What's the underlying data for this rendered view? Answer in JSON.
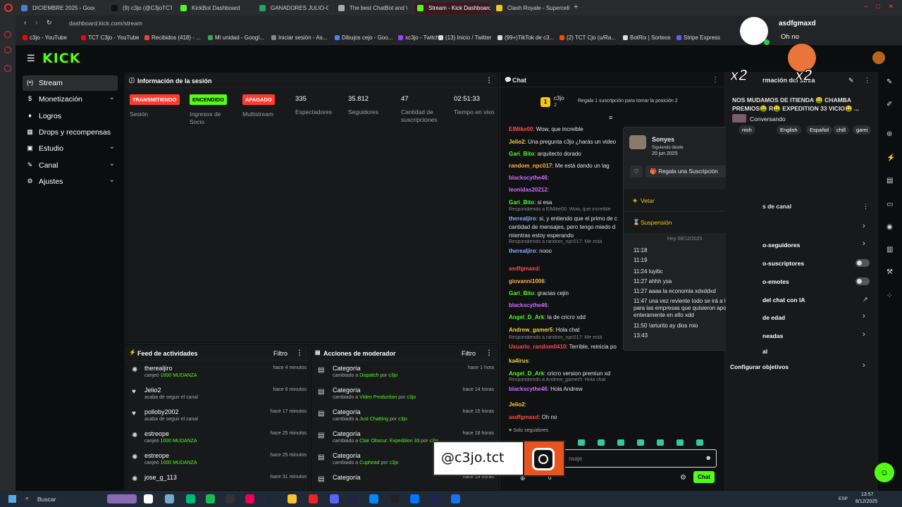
{
  "browser": {
    "tabs": [
      {
        "label": "DICIEMBRE 2025 - Goog",
        "color": "#4a7fd4"
      },
      {
        "label": "(9) c3jo (@C3joTCT) / X",
        "color": "#111111"
      },
      {
        "label": "KickBot Dashboard",
        "color": "#53fc18"
      },
      {
        "label": "GANADORES JULIO-OCT",
        "color": "#21a366"
      },
      {
        "label": "The best ChatBot and W",
        "color": "#aaaaaa"
      },
      {
        "label": "Stream - Kick Dashboard",
        "color": "#53fc18"
      },
      {
        "label": "Clash Royale - Supercell",
        "color": "#f4c430"
      }
    ],
    "url": "dashboard.kick.com/stream",
    "bookmarks": [
      {
        "label": "c3jo - YouTube",
        "color": "#ff0000"
      },
      {
        "label": "TCT C3jo - YouTube",
        "color": "#ff0000"
      },
      {
        "label": "Recibidos (418) - ...",
        "color": "#ea4335"
      },
      {
        "label": "Mi unidad - Googl...",
        "color": "#34a853"
      },
      {
        "label": "Iniciar sesión - As...",
        "color": "#888888"
      },
      {
        "label": "Dibujos cejo - Goo...",
        "color": "#4285f4"
      },
      {
        "label": "xc3jo - Twitch",
        "color": "#9146ff"
      },
      {
        "label": "(13) Inicio / Twitter",
        "color": "#dddddd"
      },
      {
        "label": "(99+)TikTok de c3...",
        "color": "#dddddd"
      },
      {
        "label": "(2) TCT Cjo (u/Ra...",
        "color": "#ff4500"
      },
      {
        "label": "BotRix | Sorteos",
        "color": "#dddddd"
      },
      {
        "label": "Stripe Express",
        "color": "#635bff"
      }
    ]
  },
  "kick": {
    "logo": "KICK",
    "sidebar": [
      {
        "label": "Stream",
        "icon": "(•)",
        "chevron": false,
        "active": true
      },
      {
        "label": "Monetización",
        "icon": "$",
        "chevron": true,
        "active": false
      },
      {
        "label": "Logros",
        "icon": "♦",
        "chevron": false,
        "active": false
      },
      {
        "label": "Drops y recompensas",
        "icon": "▦",
        "chevron": false,
        "active": false
      },
      {
        "label": "Estudio",
        "icon": "▣",
        "chevron": true,
        "active": false
      },
      {
        "label": "Canal",
        "icon": "✎",
        "chevron": true,
        "active": false
      },
      {
        "label": "Ajustes",
        "icon": "⚙",
        "chevron": true,
        "active": false
      }
    ],
    "session": {
      "title": "Información de la sesión",
      "badges": [
        {
          "text": "TRANSMITIENDO",
          "label": "Sesión",
          "bg": "#ff3b30",
          "fg": "#ffffff"
        },
        {
          "text": "ENCENDIDO",
          "label": "Ingresos de Socio",
          "bg": "#53fc18",
          "fg": "#000000"
        },
        {
          "text": "APAGADO",
          "label": "Multistream",
          "bg": "#ff3b30",
          "fg": "#ffffff"
        }
      ],
      "stats": [
        {
          "value": "335",
          "label": "Espectadores"
        },
        {
          "value": "35.812",
          "label": "Seguidores"
        },
        {
          "value": "47",
          "label": "Cantidad de suscripciones"
        },
        {
          "value": "02:51:33",
          "label": "Tiempo en vivo"
        }
      ]
    },
    "feed": {
      "title": "Feed de actividades",
      "filter": "Filtro",
      "items": [
        {
          "name": "therealjiro",
          "pre": "canjeó ",
          "hl": "1000 MUDANZA",
          "post": "",
          "time": "hace 4 minutos",
          "icon": "✺"
        },
        {
          "name": "Jelio2",
          "pre": "acaba de seguir el canal",
          "hl": "",
          "post": "",
          "time": "hace 6 minutos",
          "icon": "♥"
        },
        {
          "name": "polloby2002",
          "pre": "acaba de seguir el canal",
          "hl": "",
          "post": "",
          "time": "hace 17 minutos",
          "icon": "♥"
        },
        {
          "name": "estreope",
          "pre": "canjeó ",
          "hl": "1000 MUDANZA",
          "post": "",
          "time": "hace 25 minutos",
          "icon": "✺"
        },
        {
          "name": "estreope",
          "pre": "canjeó ",
          "hl": "1000 MUDANZA",
          "post": "",
          "time": "hace 25 minutos",
          "icon": "✺"
        },
        {
          "name": "jose_g_113",
          "pre": "",
          "hl": "",
          "post": "",
          "time": "hace 31 minutos",
          "icon": "✺"
        }
      ]
    },
    "mod": {
      "title": "Acciones de moderador",
      "filter": "Filtro",
      "items": [
        {
          "name": "Categoría",
          "pre": "cambiado a ",
          "hl": "Dispatch",
          "post": " por ",
          "user": "c3jo",
          "time": "hace 1 hora"
        },
        {
          "name": "Categoría",
          "pre": "cambiado a ",
          "hl": "Video Production",
          "post": " por ",
          "user": "c3jo",
          "time": "hace 14 horas"
        },
        {
          "name": "Categoría",
          "pre": "cambiado a ",
          "hl": "Just Chatting",
          "post": " por ",
          "user": "c3jo",
          "time": "hace 15 horas"
        },
        {
          "name": "Categoría",
          "pre": "cambiado a ",
          "hl": "Clair Obscur: Expedition 33",
          "post": " por ",
          "user": "c3jo",
          "time": "hace 18 horas"
        },
        {
          "name": "Categoría",
          "pre": "cambiado a ",
          "hl": "Cuphead",
          "post": " por ",
          "user": "c3jo",
          "time": "hace 19 horas"
        },
        {
          "name": "Categoría",
          "pre": "",
          "hl": "",
          "post": "",
          "user": "",
          "time": "hace 19 horas"
        }
      ]
    },
    "chat": {
      "title": "Chat",
      "pinned_user": "c3jo",
      "pinned_rank": "1",
      "pinned_count": "2",
      "gift_text": "Regala 1 suscripción para tomar la posición 2",
      "only_followers": "Solo seguidores",
      "placeholder": "nsaje",
      "send": "Chat",
      "counter": "0",
      "messages": [
        {
          "user": "ElMike00",
          "color": "#ff4d4d",
          "text": ": Wow, que increible"
        },
        {
          "user": "Jelio2",
          "color": "#f5d33b",
          "text": ": Una pregunta c3jo ¿harás un video"
        },
        {
          "user": "Gari_Bito",
          "color": "#53fc18",
          "text": ": arquitecto dorado"
        },
        {
          "user": "random_npc017",
          "color": "#ffb347",
          "text": ": Me está dando un lag"
        },
        {
          "user": "blackscythe46",
          "color": "#d16dff",
          "text": ":"
        },
        {
          "user": "leonidas20212",
          "color": "#d16dff",
          "text": ":"
        },
        {
          "user": "Gari_Bito",
          "color": "#53fc18",
          "text": ": si esa"
        },
        {
          "user": "therealjiro",
          "color": "#7fb2ff",
          "text": ": si, y entiendo que el primo de c",
          "reply": "Respondiendo a ElMike00: Wow, que increíble"
        },
        {
          "user": "",
          "color": "#e6e6e6",
          "text": "cantidad de mensajes, pero tengo miedo d"
        },
        {
          "user": "",
          "color": "#e6e6e6",
          "text": "mientras estoy esperando"
        },
        {
          "user": "therealjiro",
          "color": "#7fb2ff",
          "text": ": nooo",
          "reply": "Respondiendo a random_npc017: Me está"
        },
        {
          "user": "asdfgmaxd",
          "color": "#ff4d4d",
          "text": ":"
        },
        {
          "user": "giovanni1006",
          "color": "#ffb347",
          "text": ":"
        },
        {
          "user": "Gari_Bito",
          "color": "#53fc18",
          "text": ": gracias cejin"
        },
        {
          "user": "blackscythe46",
          "color": "#d16dff",
          "text": ":"
        },
        {
          "user": "Angel_D_Ark",
          "color": "#53fc18",
          "text": ": la de cricro xdd"
        },
        {
          "user": "Andrew_gamer5",
          "color": "#f5d33b",
          "text": ": Hola chat"
        },
        {
          "user": "Usuario_random0410",
          "color": "#ff4d4d",
          "text": ": Terrible, reinicia po",
          "reply": "Respondiendo a random_npc017: Me está"
        },
        {
          "user": "ka4irus",
          "color": "#f5d33b",
          "text": ":"
        },
        {
          "user": "Angel_D_Ark",
          "color": "#53fc18",
          "text": ": cricro version premiun xd"
        },
        {
          "user": "blackscythe46",
          "color": "#d16dff",
          "text": ": Hola Andrew",
          "reply": "Respondiendo a Andrew_gamer5: Hola chat"
        },
        {
          "user": "Jelio2",
          "color": "#f5d33b",
          "text": ":"
        },
        {
          "user": "asdfgmaxd",
          "color": "#ff4d4d",
          "text": ": Oh no"
        }
      ]
    },
    "popup": {
      "username": "Sonyes",
      "since_label": "Siguiendo desde",
      "since_date": "20 jun 2025",
      "gift_button": "Regala una Suscripción",
      "ban": "Vetar",
      "timeout": "Suspensión",
      "date_sep": "Hoy 08/12/2025",
      "messages": [
        {
          "time": "11:18",
          "text": ""
        },
        {
          "time": "11:19",
          "text": ""
        },
        {
          "time": "11:24",
          "text": "luyitic"
        },
        {
          "time": "11:27",
          "text": "ahhh ysa"
        },
        {
          "time": "11:27",
          "text": "aaaa la economia xdxddxd"
        },
        {
          "time": "11:47",
          "text": "una vez reviente todo se irá a la mrd para las empresas que quisieron apostar enteramente en ello xdd"
        },
        {
          "time": "11:50",
          "text": "!arturito ay dios mio"
        },
        {
          "time": "13:43",
          "text": ""
        }
      ]
    },
    "right": {
      "title": "rmación del strea",
      "stream_title": "NOS MUDAMOS DE ITIENDA 🤑 CHAMBA PREMIOS🤑 R🤑 EXPEDITION 33 VICIO🤑 ...",
      "category": "Conversando",
      "tags": [
        "nish",
        "English",
        "Español",
        "chill",
        "gami"
      ],
      "section": "s de canal",
      "options": [
        {
          "label": "",
          "type": "chevron"
        },
        {
          "label": "o-seguidores",
          "type": "chevron"
        },
        {
          "label": "o-suscriptores",
          "type": "toggle"
        },
        {
          "label": "o-emotes",
          "type": "toggle"
        },
        {
          "label": "del chat con IA",
          "type": "link"
        },
        {
          "label": "de edad",
          "type": "chevron"
        },
        {
          "label": "neadas",
          "type": "chevron"
        },
        {
          "label": "al",
          "type": "none"
        },
        {
          "label": "Configurar objetivos",
          "type": "chevron"
        }
      ]
    }
  },
  "overlay": {
    "notif_user": "asdfgmaxd",
    "notif_msg": "Oh no",
    "multiplier": "x2",
    "instagram": "@c3jo.tct"
  },
  "taskbar": {
    "search": "Buscar",
    "lang": "ESP",
    "time": "13:57",
    "date": "8/12/2025"
  }
}
